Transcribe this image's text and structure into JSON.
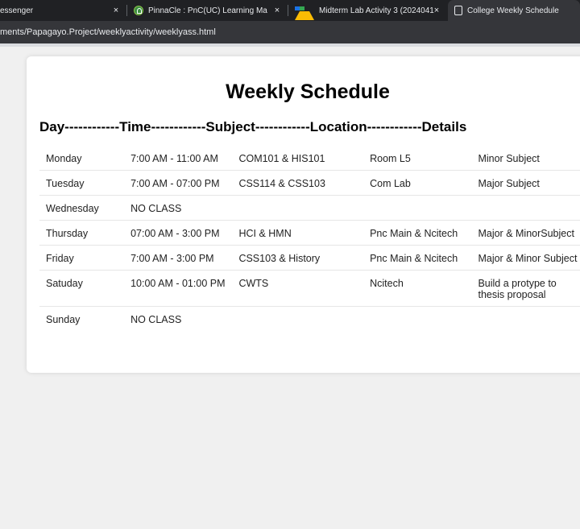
{
  "browser": {
    "tabs": [
      {
        "title": "essenger",
        "favicon": "messenger-icon",
        "active": false
      },
      {
        "title": "PinnaCle : PnC(UC) Learning Ma",
        "favicon": "pinnacle-icon",
        "active": false
      },
      {
        "title": "Midterm Lab Activity 3 (2024041",
        "favicon": "google-drive-icon",
        "active": false
      },
      {
        "title": "College Weekly Schedule",
        "favicon": "document-icon",
        "active": true
      }
    ],
    "close_glyph": "×",
    "address": "ments/Papagayo.Project/weeklyactivity/weeklyass.html"
  },
  "page": {
    "title": "Weekly Schedule",
    "column_header": "Day------------Time------------Subject------------Location------------Details",
    "rows": [
      {
        "day": "Monday",
        "time": "7:00 AM - 11:00 AM",
        "subject": "COM101 & HIS101",
        "location": "Room L5",
        "details": "Minor Subject"
      },
      {
        "day": "Tuesday",
        "time": "7:00 AM - 07:00 PM",
        "subject": "CSS114 & CSS103",
        "location": "Com Lab",
        "details": "Major Subject"
      },
      {
        "day": "Wednesday",
        "time": "NO CLASS",
        "subject": "",
        "location": "",
        "details": ""
      },
      {
        "day": "Thursday",
        "time": "07:00 AM - 3:00 PM",
        "subject": "HCI & HMN",
        "location": "Pnc Main & Ncitech",
        "details": "Major & MinorSubject"
      },
      {
        "day": "Friday",
        "time": "7:00 AM - 3:00 PM",
        "subject": "CSS103 & History",
        "location": "Pnc Main & Ncitech",
        "details": "Major & Minor Subject"
      },
      {
        "day": "Satuday",
        "time": "10:00 AM - 01:00 PM",
        "subject": "CWTS",
        "location": "Ncitech",
        "details": "Build a protype to thesis proposal"
      },
      {
        "day": "Sunday",
        "time": "NO CLASS",
        "subject": "",
        "location": "",
        "details": ""
      }
    ]
  }
}
